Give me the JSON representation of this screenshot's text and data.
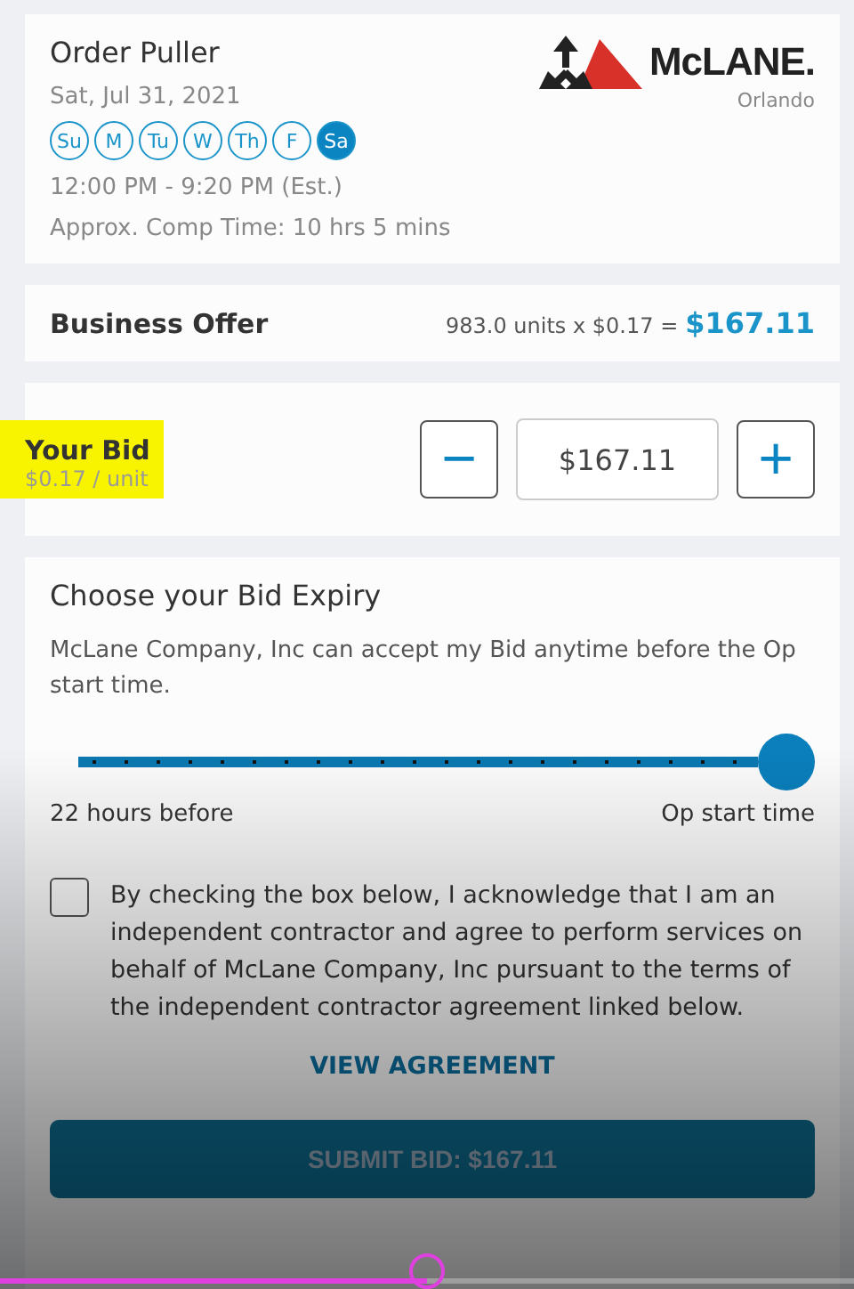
{
  "job": {
    "title": "Order Puller",
    "date": "Sat, Jul 31, 2021",
    "logo": "McLANE.",
    "location": "Orlando",
    "days": [
      {
        "label": "Su",
        "selected": false
      },
      {
        "label": "M",
        "selected": false
      },
      {
        "label": "Tu",
        "selected": false
      },
      {
        "label": "W",
        "selected": false
      },
      {
        "label": "Th",
        "selected": false
      },
      {
        "label": "F",
        "selected": false
      },
      {
        "label": "Sa",
        "selected": true
      }
    ],
    "hours": "12:00 PM - 9:20 PM (Est.)",
    "comp_time": "Approx. Comp Time: 10 hrs 5 mins"
  },
  "business_offer": {
    "label": "Business Offer",
    "formula": "983.0 units x $0.17 =",
    "total": "$167.11"
  },
  "your_bid": {
    "label": "Your Bid",
    "rate": "$0.17 / unit",
    "highlighted": true,
    "minus": "−",
    "value": "$167.11",
    "plus": "+"
  },
  "expiry": {
    "title": "Choose your Bid Expiry",
    "text": "McLane Company, Inc can accept my Bid anytime before the Op start time.",
    "level": 1,
    "min_label": "22 hours before",
    "max_label": "Op start time"
  },
  "agreement": {
    "checked": false,
    "text": "By checking the box below, I acknowledge that I am an independent contractor and agree to perform services on behalf of McLane Company, Inc pursuant to the terms of the independent contractor agreement linked below.",
    "link": "VIEW AGREEMENT"
  },
  "submit": "SUBMIT BID: $167.11",
  "video_progress": {
    "level": 0.5
  }
}
